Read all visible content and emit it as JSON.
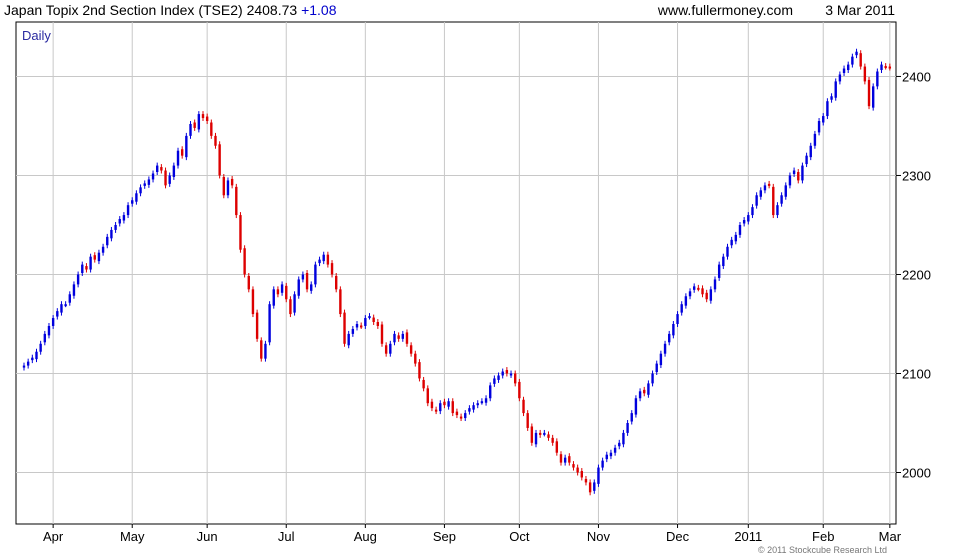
{
  "header": {
    "title": "Japan Topix 2nd Section Index (TSE2)",
    "last": "2408.73",
    "change": "+1.08",
    "site": "www.fullermoney.com",
    "date": "3 Mar 2011"
  },
  "copyright": "© 2011 Stockcube Research Ltd",
  "colors": {
    "up": "#0000dd",
    "down": "#dd0000",
    "grid": "#c8c8c8",
    "axis": "#000000"
  },
  "chart_data": {
    "type": "candlestick",
    "period_label": "Daily",
    "y_ticks": [
      "2000",
      "2100",
      "2200",
      "2300",
      "2400"
    ],
    "x_ticks": [
      "Apr",
      "May",
      "Jun",
      "Jul",
      "Aug",
      "Sep",
      "Oct",
      "Nov",
      "Dec",
      "2011",
      "Feb",
      "Mar"
    ],
    "ylim": [
      1948,
      2455
    ],
    "grid": true,
    "closes": [
      2108,
      2112,
      2116,
      2122,
      2130,
      2140,
      2148,
      2156,
      2163,
      2170,
      2170,
      2180,
      2190,
      2200,
      2210,
      2205,
      2218,
      2215,
      2222,
      2228,
      2238,
      2245,
      2250,
      2256,
      2260,
      2270,
      2275,
      2282,
      2288,
      2292,
      2296,
      2302,
      2310,
      2305,
      2290,
      2300,
      2310,
      2325,
      2320,
      2340,
      2352,
      2348,
      2362,
      2358,
      2355,
      2340,
      2330,
      2300,
      2280,
      2295,
      2290,
      2260,
      2225,
      2200,
      2185,
      2160,
      2135,
      2115,
      2130,
      2170,
      2185,
      2180,
      2190,
      2175,
      2160,
      2180,
      2195,
      2200,
      2185,
      2190,
      2210,
      2215,
      2220,
      2210,
      2200,
      2185,
      2160,
      2130,
      2140,
      2145,
      2150,
      2148,
      2156,
      2158,
      2152,
      2148,
      2130,
      2120,
      2130,
      2140,
      2135,
      2140,
      2130,
      2120,
      2110,
      2095,
      2085,
      2070,
      2065,
      2062,
      2070,
      2068,
      2072,
      2060,
      2058,
      2055,
      2060,
      2065,
      2068,
      2070,
      2072,
      2075,
      2088,
      2095,
      2098,
      2102,
      2100,
      2100,
      2090,
      2075,
      2060,
      2045,
      2030,
      2040,
      2038,
      2040,
      2035,
      2030,
      2020,
      2010,
      2015,
      2010,
      2005,
      2000,
      1995,
      1990,
      1980,
      1990,
      2005,
      2012,
      2018,
      2020,
      2025,
      2030,
      2040,
      2050,
      2060,
      2075,
      2082,
      2080,
      2090,
      2100,
      2110,
      2120,
      2130,
      2140,
      2150,
      2160,
      2170,
      2178,
      2183,
      2188,
      2186,
      2180,
      2175,
      2185,
      2195,
      2210,
      2218,
      2228,
      2235,
      2240,
      2250,
      2255,
      2260,
      2268,
      2280,
      2285,
      2290,
      2290,
      2260,
      2270,
      2280,
      2290,
      2300,
      2305,
      2295,
      2310,
      2320,
      2330,
      2342,
      2355,
      2360,
      2375,
      2380,
      2395,
      2402,
      2408,
      2412,
      2420,
      2425,
      2410,
      2395,
      2370,
      2390,
      2405,
      2412,
      2410,
      2409
    ]
  }
}
